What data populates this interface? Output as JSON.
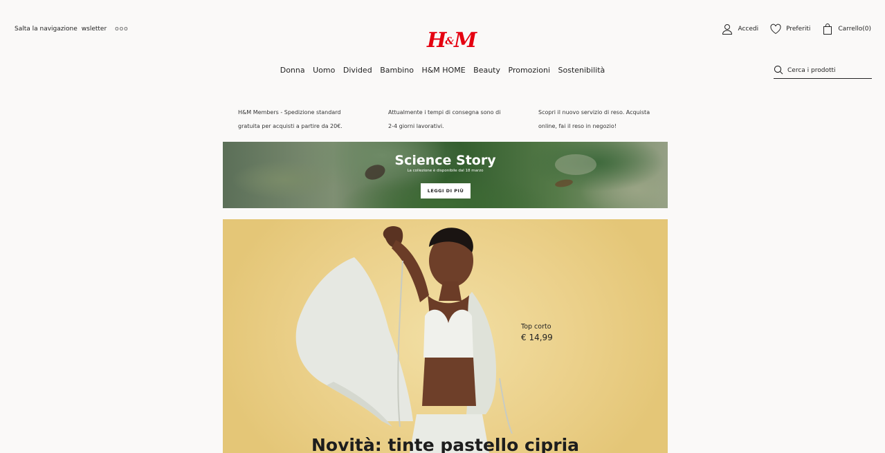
{
  "utility": {
    "skip_nav": "Salta la navigazione",
    "newsletter": "wsletter",
    "dots": "ooo"
  },
  "brand": {
    "logo_left": "H",
    "logo_amp": "&",
    "logo_right": "M",
    "brand_color": "#e50010"
  },
  "account": {
    "login": "Accedi",
    "favorites": "Preferiti",
    "cart": "Carrello(0)"
  },
  "nav": {
    "items": [
      "Donna",
      "Uomo",
      "Divided",
      "Bambino",
      "H&M HOME",
      "Beauty",
      "Promozioni",
      "Sostenibilità"
    ]
  },
  "search": {
    "placeholder": "Cerca i prodotti"
  },
  "info": {
    "items": [
      {
        "line1": "H&M Members - Spedizione standard",
        "line2": "gratuita per acquisti a partire da 20€."
      },
      {
        "line1": "Attualmente i tempi di consegna sono di",
        "line2": "2-4 giorni lavorativi."
      },
      {
        "line1": "Scopri il nuovo servizio di reso. Acquista",
        "line2": "online, fai il reso in negozio!"
      }
    ]
  },
  "banner": {
    "title": "Science Story",
    "subtitle": "La collezione è disponibile dal 18 marzo",
    "button": "LEGGI DI PIÙ"
  },
  "hero": {
    "product_label": "Top corto",
    "product_price": "€ 14,99",
    "headline": "Novità: tinte pastello cipria",
    "background_color": "#ecd08a"
  }
}
